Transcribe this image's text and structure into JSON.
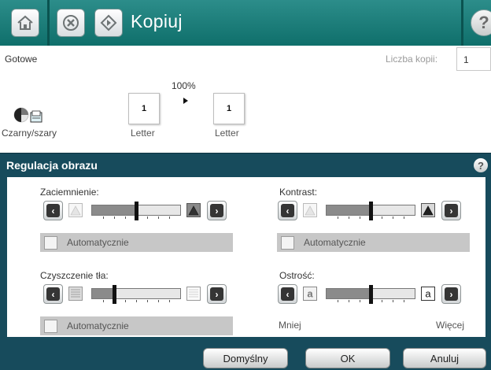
{
  "header": {
    "title": "Kopiuj",
    "home_icon": "home-icon",
    "stop_icon": "stop-icon",
    "start_icon": "start-icon",
    "help_icon": "help-icon"
  },
  "status": {
    "text": "Gotowe",
    "copies_label": "Liczba kopii:",
    "copies_value": "1"
  },
  "copy_preview": {
    "zoom": "100%",
    "source_page": "1",
    "source_paper": "Letter",
    "output_page": "1",
    "output_paper": "Letter",
    "color_mode": "Czarny/szary"
  },
  "dialog": {
    "title": "Regulacja obrazu",
    "darkness": {
      "label": "Zaciemnienie:",
      "level": 0.5,
      "auto_label": "Automatycznie",
      "auto_checked": false
    },
    "contrast": {
      "label": "Kontrast:",
      "level": 0.5,
      "auto_label": "Automatycznie",
      "auto_checked": false
    },
    "background_cleanup": {
      "label": "Czyszczenie tła:",
      "level": 0.25,
      "auto_label": "Automatycznie",
      "auto_checked": false
    },
    "sharpness": {
      "label": "Ostrość:",
      "level": 0.5,
      "min_label": "Mniej",
      "max_label": "Więcej",
      "glyph": "a"
    }
  },
  "buttons": {
    "default": "Domyślny",
    "ok": "OK",
    "cancel": "Anuluj"
  },
  "colors": {
    "header": "#1a7d79",
    "dialog_frame": "#174b5c",
    "slider_fill": "#8b8b8b",
    "checkbox_row": "#c7c7c7"
  }
}
